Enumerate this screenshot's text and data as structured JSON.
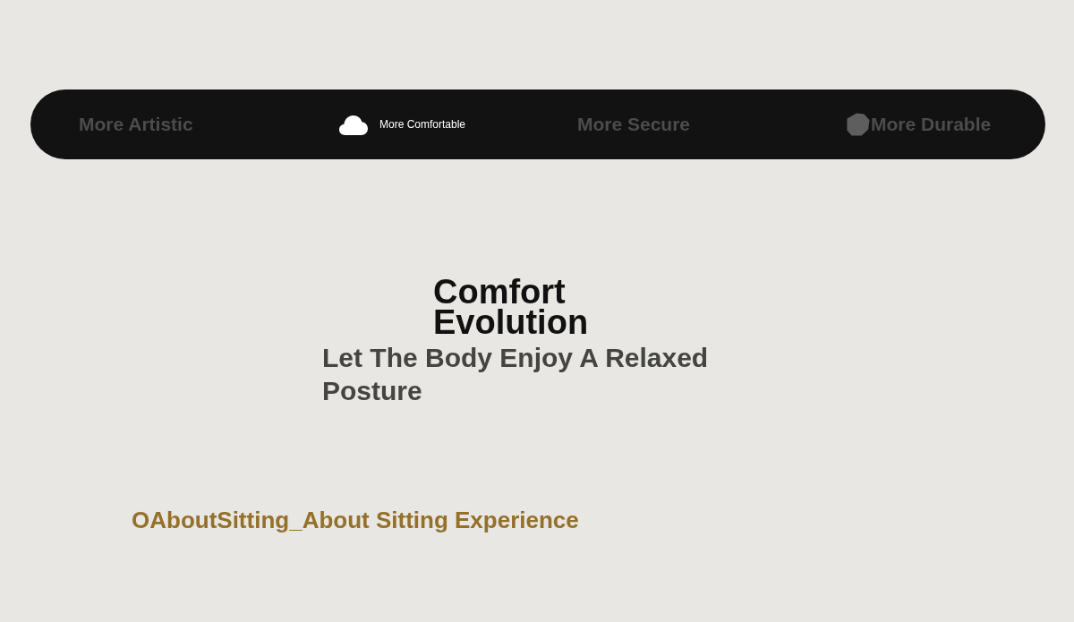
{
  "tabs": [
    {
      "label": "More Artistic",
      "selected": false,
      "icon_visible": false
    },
    {
      "label": "More Comfortable",
      "selected": true,
      "icon_visible": true
    },
    {
      "label": "More Secure",
      "selected": false,
      "icon_visible": false
    },
    {
      "label": "More Durable",
      "selected": false,
      "icon_visible": true
    }
  ],
  "headline": "Comfort Evolution",
  "subheading": "Let The Body Enjoy A Relaxed Posture",
  "section_title": "OAboutSitting_About Sitting Experience"
}
